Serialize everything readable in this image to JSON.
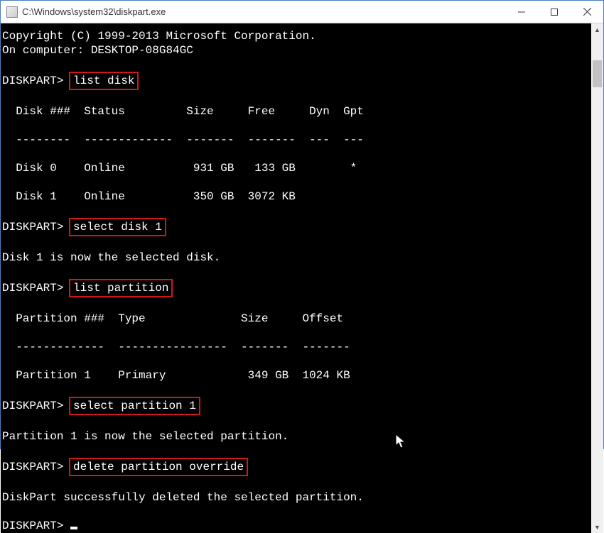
{
  "window": {
    "title": "C:\\Windows\\system32\\diskpart.exe"
  },
  "header": {
    "copyright": "Copyright (C) 1999-2013 Microsoft Corporation.",
    "on_computer": "On computer: DESKTOP-08G84GC"
  },
  "prompt": "DISKPART>",
  "commands": {
    "cmd1": "list disk",
    "cmd2": "select disk 1",
    "cmd3": "list partition",
    "cmd4": "select partition 1",
    "cmd5": "delete partition override"
  },
  "disk_table": {
    "header": "  Disk ###  Status         Size     Free     Dyn  Gpt",
    "divider": "  --------  -------------  -------  -------  ---  ---",
    "rows": [
      "  Disk 0    Online          931 GB   133 GB        *",
      "  Disk 1    Online          350 GB  3072 KB"
    ]
  },
  "messages": {
    "disk_selected": "Disk 1 is now the selected disk.",
    "partition_selected": "Partition 1 is now the selected partition.",
    "partition_deleted": "DiskPart successfully deleted the selected partition."
  },
  "partition_table": {
    "header": "  Partition ###  Type              Size     Offset",
    "divider": "  -------------  ----------------  -------  -------",
    "rows": [
      "  Partition 1    Primary            349 GB  1024 KB"
    ]
  },
  "highlight_color": "#d11818"
}
